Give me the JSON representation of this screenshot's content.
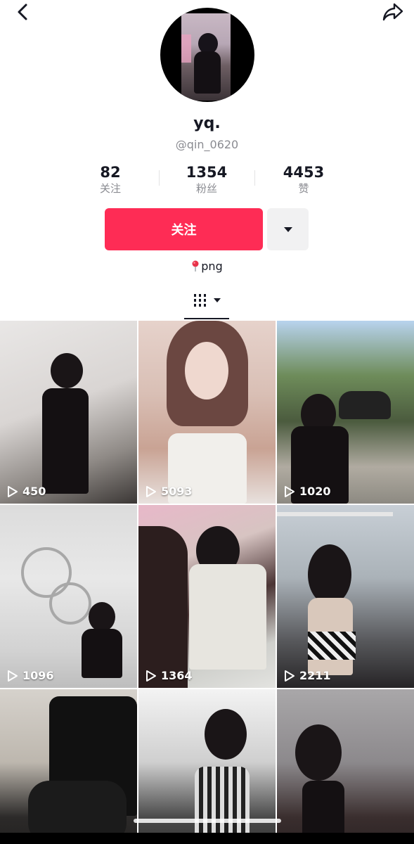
{
  "profile": {
    "username": "yq.",
    "handle": "@qin_0620",
    "bio": "png"
  },
  "stats": {
    "following": {
      "value": "82",
      "label": "关注"
    },
    "followers": {
      "value": "1354",
      "label": "粉丝"
    },
    "likes": {
      "value": "4453",
      "label": "赞"
    }
  },
  "actions": {
    "follow_label": "关注"
  },
  "icons": {
    "back": "chevron-left-icon",
    "share": "share-arrow-icon",
    "more": "caret-down-icon",
    "location": "pin-icon",
    "videos_tab": "grid-bars-icon",
    "play": "play-icon"
  },
  "colors": {
    "accent": "#fe2c55",
    "secondary_button": "#f1f1f2",
    "muted_text": "#8a8b91"
  },
  "videos": [
    {
      "views": "450"
    },
    {
      "views": "5093"
    },
    {
      "views": "1020"
    },
    {
      "views": "1096"
    },
    {
      "views": "1364"
    },
    {
      "views": "2211"
    },
    {
      "views": ""
    },
    {
      "views": ""
    },
    {
      "views": ""
    }
  ]
}
